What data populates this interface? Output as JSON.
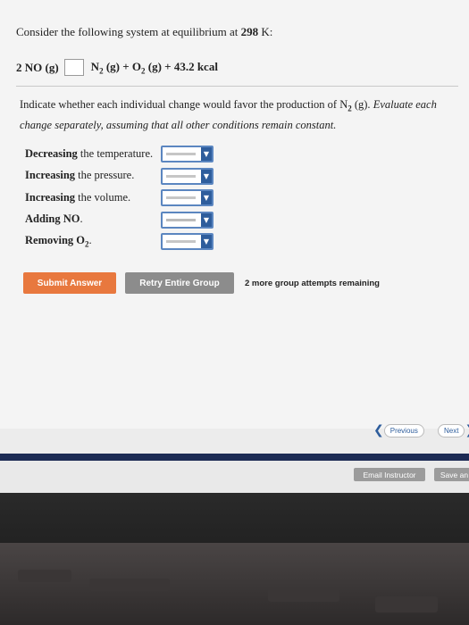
{
  "question": {
    "prefix": "Consider the following system at equilibrium at ",
    "temp": "298",
    "suffix": " K:"
  },
  "equation": {
    "reactant": "2 NO (g)",
    "product_n2": "N",
    "product_n2_sub": "2",
    "product_n2_tail": " (g) + O",
    "product_o2_sub": "2",
    "product_tail": " (g) + 43.2 kcal"
  },
  "instruction": {
    "lead": "Indicate whether each individual change would favor the production of N",
    "sub": "2",
    "mid": " (g). ",
    "italic": "Evaluate each change separately, assuming that all other conditions remain constant."
  },
  "changes": [
    {
      "bold": "Decreasing",
      "rest": " the temperature."
    },
    {
      "bold": "Increasing",
      "rest": " the pressure."
    },
    {
      "bold": "Increasing",
      "rest": " the volume."
    },
    {
      "bold": "Adding NO",
      "rest": "."
    },
    {
      "bold": "Removing O",
      "sub": "2",
      "rest": "."
    }
  ],
  "buttons": {
    "submit": "Submit Answer",
    "retry": "Retry Entire Group",
    "attempts": "2 more group attempts remaining"
  },
  "nav": {
    "previous": "Previous",
    "next": "Next"
  },
  "footer": {
    "email": "Email Instructor",
    "save": "Save an"
  },
  "colors": {
    "submit": "#e8783e",
    "retry": "#8c8c8c",
    "select_border": "#5b86c0",
    "select_arrow": "#2e5d9c",
    "footer_bar": "#1d2b54"
  }
}
